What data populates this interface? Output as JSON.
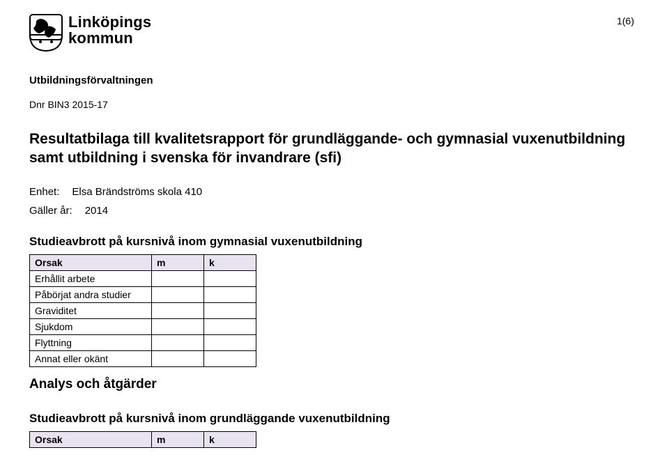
{
  "header": {
    "brand_name": "Linköpings",
    "brand_sub": "kommun",
    "page_number": "1(6)"
  },
  "department": "Utbildningsförvaltningen",
  "dnr": "Dnr BIN3 2015-17",
  "title": "Resultatbilaga till kvalitetsrapport för grundläggande- och gymnasial vuxenutbildning samt utbildning i svenska för invandrare (sfi)",
  "enhet": {
    "label": "Enhet:",
    "value": "Elsa Brändströms skola 410"
  },
  "galler": {
    "label": "Gäller år:",
    "value": "2014"
  },
  "section1": {
    "heading": "Studieavbrott på kursnivå inom gymnasial vuxenutbildning",
    "headers": {
      "orsak": "Orsak",
      "m": "m",
      "k": "k"
    },
    "rows": [
      {
        "orsak": "Erhållit arbete",
        "m": "",
        "k": ""
      },
      {
        "orsak": "Påbörjat andra studier",
        "m": "",
        "k": ""
      },
      {
        "orsak": "Graviditet",
        "m": "",
        "k": ""
      },
      {
        "orsak": "Sjukdom",
        "m": "",
        "k": ""
      },
      {
        "orsak": "Flyttning",
        "m": "",
        "k": ""
      },
      {
        "orsak": "Annat eller okänt",
        "m": "",
        "k": ""
      }
    ]
  },
  "analys_heading": "Analys och åtgärder",
  "section2": {
    "heading": "Studieavbrott på kursnivå inom grundläggande vuxenutbildning",
    "headers": {
      "orsak": "Orsak",
      "m": "m",
      "k": "k"
    }
  }
}
